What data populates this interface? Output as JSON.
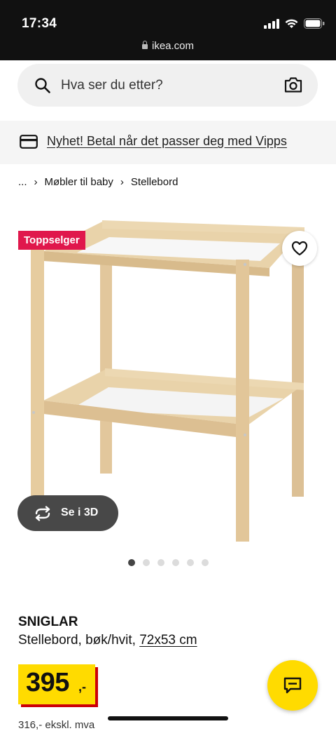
{
  "status_bar": {
    "time": "17:34"
  },
  "browser": {
    "url": "ikea.com"
  },
  "search": {
    "placeholder": "Hva ser du etter?"
  },
  "promo": {
    "text": "Nyhet! Betal når det passer deg med Vipps"
  },
  "breadcrumb": {
    "ellipsis": "...",
    "items": [
      "Møbler til baby",
      "Stellebord"
    ]
  },
  "product": {
    "badge": "Toppselger",
    "view_3d_label": "Se i 3D",
    "image_count": 6,
    "active_image_index": 0,
    "name": "SNIGLAR",
    "description_prefix": "Stellebord, bøk/hvit, ",
    "dimensions": "72x53 cm",
    "price_main": "395",
    "price_suffix": ",-",
    "price_ex_vat": "316,- ekskl. mva"
  },
  "colors": {
    "ikea_yellow": "#ffdb00",
    "badge_red": "#e0174c",
    "price_shadow": "#cc0008"
  },
  "icons": [
    "search-icon",
    "camera-icon",
    "card-icon",
    "heart-icon",
    "rotate-3d-icon",
    "chat-icon",
    "lock-icon",
    "signal-icon",
    "wifi-icon",
    "battery-icon"
  ]
}
